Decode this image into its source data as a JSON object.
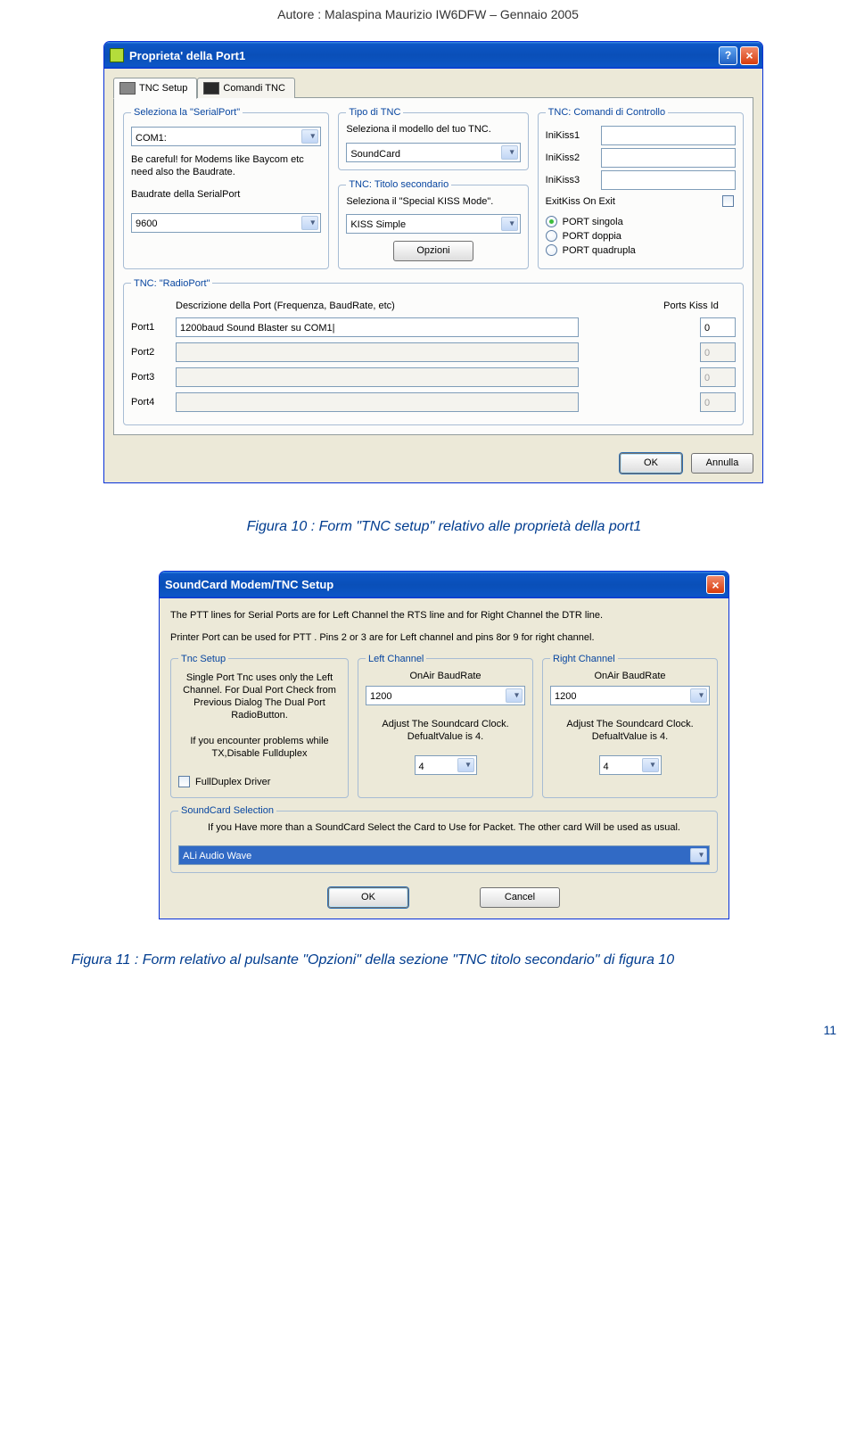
{
  "page_header": "Autore : Malaspina Maurizio IW6DFW – Gennaio 2005",
  "caption1": "Figura 10 : Form \"TNC setup\" relativo alle proprietà della port1",
  "caption2": "Figura 11 : Form relativo al pulsante \"Opzioni\" della sezione \"TNC titolo secondario\" di figura 10",
  "page_num": "11",
  "dialog1": {
    "title": "Proprieta' della Port1",
    "tabs": {
      "active": "TNC Setup",
      "inactive": "Comandi TNC"
    },
    "serial": {
      "legend": "Seleziona la \"SerialPort\"",
      "value": "COM1:",
      "warn": "Be careful! for Modems like Baycom etc need also the Baudrate.",
      "baudlabel": "Baudrate della SerialPort",
      "baud": "9600"
    },
    "tnc_type": {
      "legend": "Tipo di TNC",
      "text": "Seleziona il modello del tuo TNC.",
      "value": "SoundCard"
    },
    "tnc_sec": {
      "legend": "TNC: Titolo secondario",
      "text": "Seleziona il \"Special KISS Mode\".",
      "value": "KISS Simple",
      "btn": "Opzioni"
    },
    "tnc_cmd": {
      "legend": "TNC: Comandi di Controllo",
      "r1": "IniKiss1",
      "r2": "IniKiss2",
      "r3": "IniKiss3",
      "exit": "ExitKiss On Exit",
      "p1": "PORT singola",
      "p2": "PORT doppia",
      "p3": "PORT quadrupla"
    },
    "radioport": {
      "legend": "TNC: \"RadioPort\"",
      "desc_head": "Descrizione della Port (Frequenza, BaudRate, etc)",
      "kiss_head": "Ports Kiss Id",
      "p1l": "Port1",
      "p1v": "1200baud Sound Blaster su COM1|",
      "p1k": "0",
      "p2l": "Port2",
      "p2v": "",
      "p2k": "0",
      "p3l": "Port3",
      "p3v": "",
      "p3k": "0",
      "p4l": "Port4",
      "p4v": "",
      "p4k": "0"
    },
    "ok": "OK",
    "cancel": "Annulla"
  },
  "dialog2": {
    "title": "SoundCard Modem/TNC Setup",
    "intro1": "The PTT lines for Serial Ports are for Left Channel the RTS line and for Right Channel the DTR line.",
    "intro2": "Printer Port can be used for PTT . Pins 2 or 3 are for Left channel and pins 8or 9 for right channel.",
    "tnc_setup": {
      "legend": "Tnc Setup",
      "text1": "Single Port Tnc uses only the Left Channel. For Dual Port Check from Previous Dialog The Dual Port RadioButton.",
      "text2": "If you encounter problems while TX,Disable Fullduplex",
      "fd": "FullDuplex Driver"
    },
    "left": {
      "legend": "Left Channel",
      "lab1": "OnAir BaudRate",
      "v1": "1200",
      "lab2": "Adjust The Soundcard Clock. DefualtValue is 4.",
      "v2": "4"
    },
    "right": {
      "legend": "Right Channel",
      "lab1": "OnAir BaudRate",
      "v1": "1200",
      "lab2": "Adjust The Soundcard Clock. DefualtValue is 4.",
      "v2": "4"
    },
    "sel": {
      "legend": "SoundCard Selection",
      "text": "If you Have more than a SoundCard Select the Card to Use for Packet. The other card Will be used as usual.",
      "value": "ALi Audio Wave"
    },
    "ok": "OK",
    "cancel": "Cancel"
  }
}
